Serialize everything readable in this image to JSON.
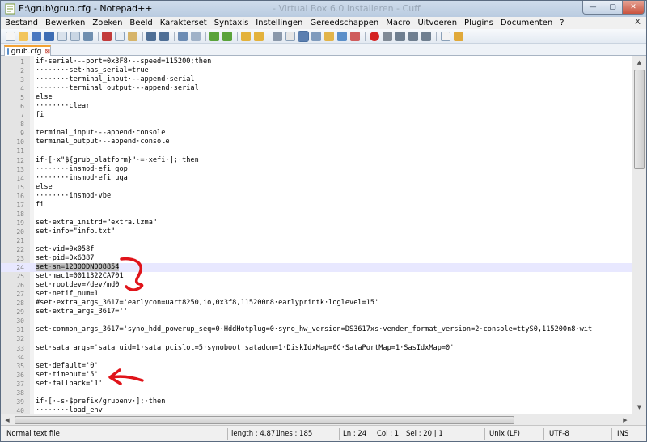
{
  "window": {
    "title": "E:\\grub\\grub.cfg - Notepad++",
    "background_title": "- Virtual Box 6.0 installeren - Cuff",
    "minimize_glyph": "—",
    "maximize_glyph": "▢",
    "close_glyph": "✕"
  },
  "menu": {
    "items": [
      "Bestand",
      "Bewerken",
      "Zoeken",
      "Beeld",
      "Karakterset",
      "Syntaxis",
      "Instellingen",
      "Gereedschappen",
      "Macro",
      "Uitvoeren",
      "Plugins",
      "Documenten",
      "?"
    ],
    "close_glyph": "X"
  },
  "tab": {
    "label": "grub.cfg",
    "close_glyph": "⊠"
  },
  "editor": {
    "lines": [
      {
        "n": "1",
        "text": "if·serial·--port=0x3F8·--speed=115200;then"
      },
      {
        "n": "2",
        "text": "········set·has_serial=true"
      },
      {
        "n": "3",
        "text": "········terminal_input·--append·serial"
      },
      {
        "n": "4",
        "text": "········terminal_output·--append·serial"
      },
      {
        "n": "5",
        "text": "else"
      },
      {
        "n": "6",
        "text": "········clear"
      },
      {
        "n": "7",
        "text": "fi"
      },
      {
        "n": "8",
        "text": ""
      },
      {
        "n": "9",
        "text": "terminal_input·--append·console"
      },
      {
        "n": "10",
        "text": "terminal_output·--append·console"
      },
      {
        "n": "11",
        "text": ""
      },
      {
        "n": "12",
        "text": "if·[·x\"${grub_platform}\"·=·xefi·];·then"
      },
      {
        "n": "13",
        "text": "········insmod·efi_gop"
      },
      {
        "n": "14",
        "text": "········insmod·efi_uga"
      },
      {
        "n": "15",
        "text": "else"
      },
      {
        "n": "16",
        "text": "········insmod·vbe"
      },
      {
        "n": "17",
        "text": "fi"
      },
      {
        "n": "18",
        "text": ""
      },
      {
        "n": "19",
        "text": "set·extra_initrd=\"extra.lzma\""
      },
      {
        "n": "20",
        "text": "set·info=\"info.txt\""
      },
      {
        "n": "21",
        "text": ""
      },
      {
        "n": "22",
        "text": "set·vid=0x058f"
      },
      {
        "n": "23",
        "text": "set·pid=0x6387"
      },
      {
        "n": "24",
        "text": "set·sn=1230ODN008854"
      },
      {
        "n": "25",
        "text": "set·mac1=0011322CA701"
      },
      {
        "n": "26",
        "text": "set·rootdev=/dev/md0"
      },
      {
        "n": "27",
        "text": "set·netif_num=1"
      },
      {
        "n": "28",
        "text": "#set·extra_args_3617='earlycon=uart8250,io,0x3f8,115200n8·earlyprintk·loglevel=15'"
      },
      {
        "n": "29",
        "text": "set·extra_args_3617=''"
      },
      {
        "n": "30",
        "text": ""
      },
      {
        "n": "31",
        "text": "set·common_args_3617='syno_hdd_powerup_seq=0·HddHotplug=0·syno_hw_version=DS3617xs·vender_format_version=2·console=ttyS0,115200n8·wit"
      },
      {
        "n": "32",
        "text": ""
      },
      {
        "n": "33",
        "text": "set·sata_args='sata_uid=1·sata_pcislot=5·synoboot_satadom=1·DiskIdxMap=0C·SataPortMap=1·SasIdxMap=0'"
      },
      {
        "n": "34",
        "text": ""
      },
      {
        "n": "35",
        "text": "set·default='0'"
      },
      {
        "n": "36",
        "text": "set·timeout='5'"
      },
      {
        "n": "37",
        "text": "set·fallback='1'"
      },
      {
        "n": "38",
        "text": ""
      },
      {
        "n": "39",
        "text": "if·[·-s·$prefix/grubenv·];·then"
      },
      {
        "n": "40",
        "text": "········load_env"
      }
    ],
    "current_line": "24",
    "selected_text": "set·sn=1230ODN008854"
  },
  "status": {
    "file_type": "Normal text file",
    "length": "length : 4.871",
    "lines": "lines : 185",
    "ln": "Ln : 24",
    "col": "Col : 1",
    "sel": "Sel : 20 | 1",
    "eol": "Unix (LF)",
    "encoding": "UTF-8",
    "mode": "INS"
  },
  "colors": {
    "annotation": "#e0141a",
    "tab_accent": "#f4a234",
    "current_line": "#e8e8ff"
  }
}
